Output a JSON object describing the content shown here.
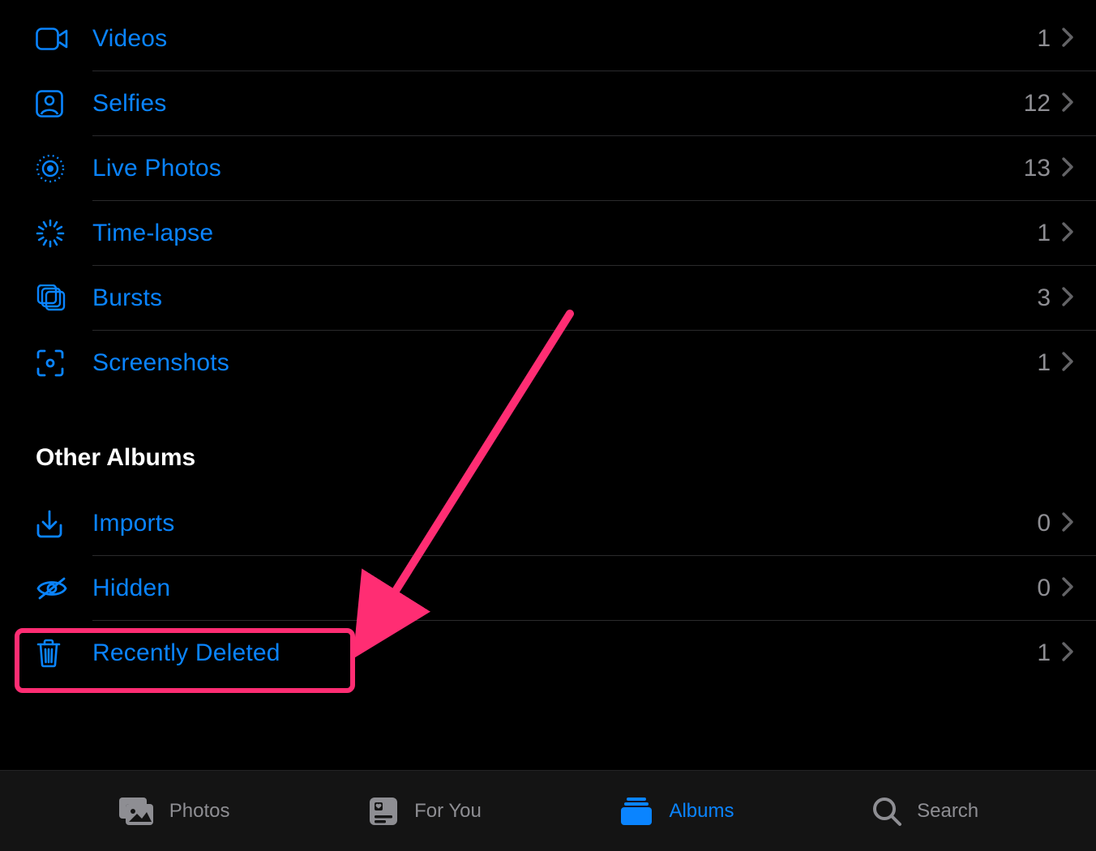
{
  "colors": {
    "accent": "#0a84ff",
    "grey": "#8e8e93",
    "highlight": "#ff2d73"
  },
  "mediaTypes": {
    "items": [
      {
        "icon": "video-icon",
        "label": "Videos",
        "count": "1"
      },
      {
        "icon": "selfie-icon",
        "label": "Selfies",
        "count": "12"
      },
      {
        "icon": "livephoto-icon",
        "label": "Live Photos",
        "count": "13"
      },
      {
        "icon": "timelapse-icon",
        "label": "Time-lapse",
        "count": "1"
      },
      {
        "icon": "bursts-icon",
        "label": "Bursts",
        "count": "3"
      },
      {
        "icon": "screenshot-icon",
        "label": "Screenshots",
        "count": "1"
      }
    ]
  },
  "otherAlbums": {
    "heading": "Other Albums",
    "items": [
      {
        "icon": "imports-icon",
        "label": "Imports",
        "count": "0"
      },
      {
        "icon": "hidden-icon",
        "label": "Hidden",
        "count": "0"
      },
      {
        "icon": "trash-icon",
        "label": "Recently Deleted",
        "count": "1"
      }
    ]
  },
  "tabs": {
    "photos": {
      "label": "Photos"
    },
    "forYou": {
      "label": "For You"
    },
    "albums": {
      "label": "Albums"
    },
    "search": {
      "label": "Search"
    }
  }
}
